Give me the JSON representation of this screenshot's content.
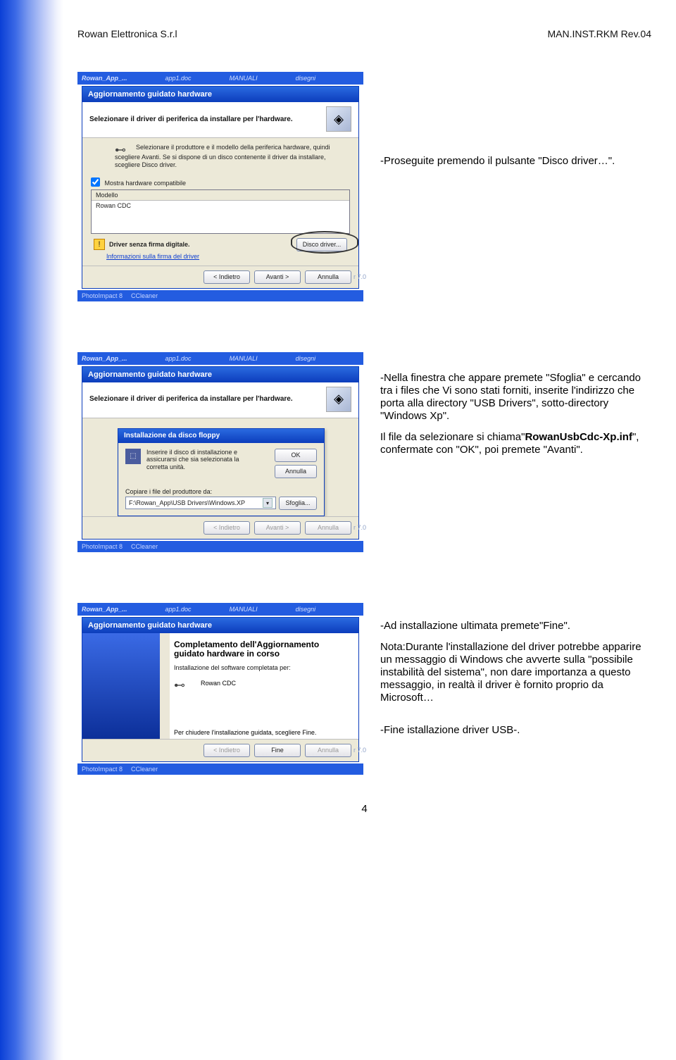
{
  "header": {
    "left": "Rowan Elettronica S.r.l",
    "right": "MAN.INST.RKM    Rev.04"
  },
  "shot1": {
    "taskbar": [
      "Rowan_App_...",
      "app1.doc",
      "MANUALI",
      "disegni"
    ],
    "title": "Aggiornamento guidato hardware",
    "top_label": "Selezionare il driver di periferica da installare per l'hardware.",
    "instr": "Selezionare il produttore e il modello della periferica hardware, quindi scegliere Avanti. Se si dispone di un disco contenente il driver da installare, scegliere Disco driver.",
    "compat": "Mostra hardware compatibile",
    "listhead": "Modello",
    "listitem": "Rowan CDC",
    "warn": "Driver senza firma digitale.",
    "warnlink": "Informazioni sulla firma del driver",
    "discbtn": "Disco driver...",
    "btns": [
      "< Indietro",
      "Avanti >",
      "Annulla"
    ],
    "foot": [
      "PhotoImpact 8",
      "CCleaner"
    ],
    "ver": "r 7.0",
    "side": "-Proseguite premendo il pulsante \"Disco driver…\"."
  },
  "shot2": {
    "top_label": "Selezionare il driver di periferica da installare per l'hardware.",
    "ftitle": "Installazione da disco floppy",
    "ftext": "Inserire il disco di installazione e assicurarsi che sia selezionata la corretta unità.",
    "ok": "OK",
    "annulla": "Annulla",
    "copy": "Copiare i file del produttore da:",
    "path": "F:\\Rowan_App\\USB Drivers\\Windows.XP",
    "sfoglia": "Sfoglia...",
    "btns": [
      "< Indietro",
      "Avanti >",
      "Annulla"
    ],
    "side_a": "-Nella finestra che appare premete \"Sfoglia\" e  cercando tra i files che Vi sono stati forniti, inserite l'indirizzo che porta alla directory \"USB Drivers\", sotto-directory \"Windows Xp\".",
    "side_b1": "Il file da selezionare si chiama\"",
    "side_b_bold": "RowanUsbCdc-Xp.inf",
    "side_b2": "\", confermate con \"OK\", poi premete \"Avanti\"."
  },
  "shot3": {
    "fintitle": "Completamento dell'Aggiornamento guidato hardware in corso",
    "finsub": "Installazione del software completata per:",
    "dev": "Rowan CDC",
    "finclose": "Per chiudere l'installazione guidata, scegliere Fine.",
    "btns_d": "< Indietro",
    "btns_f": "Fine",
    "btns_a": "Annulla",
    "s1": "-Ad installazione ultimata premete\"Fine\".",
    "s2": "Nota:Durante l'installazione del driver potrebbe apparire un messaggio di Windows che avverte sulla \"possibile instabilità del sistema\", non dare importanza a questo messaggio, in realtà il driver è fornito proprio da Microsoft…",
    "s3": "-Fine istallazione driver USB-."
  },
  "pagen": "4"
}
